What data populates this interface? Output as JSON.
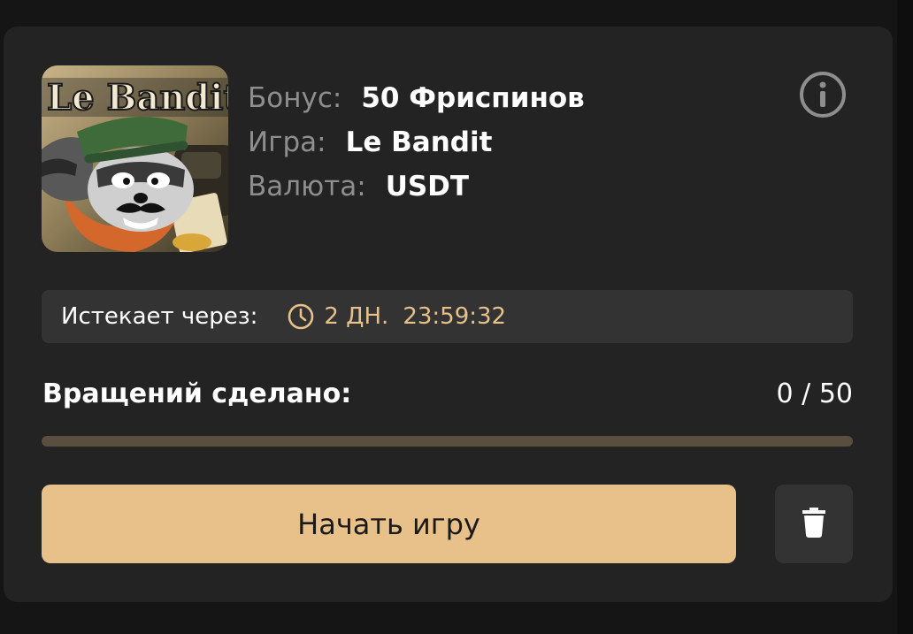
{
  "bonus": {
    "game_image_title": "Le Bandit",
    "rows": [
      {
        "label": "Бонус:",
        "value": "50 Фриспинов"
      },
      {
        "label": "Игра:",
        "value": "Le Bandit"
      },
      {
        "label": "Валюта:",
        "value": "USDT"
      }
    ],
    "info_icon": "info-circle-icon"
  },
  "expiry": {
    "label": "Истекает через:",
    "icon": "clock-icon",
    "days": "2 ДН.",
    "time": "23:59:32"
  },
  "progress": {
    "label": "Вращений сделано:",
    "count_text": "0 / 50",
    "done": 0,
    "total": 50,
    "fraction": 0.0
  },
  "actions": {
    "start_label": "Начать игру",
    "delete_icon": "trash-icon"
  },
  "colors": {
    "accent": "#e7c08a",
    "card": "#232323",
    "panel": "#333333",
    "track": "#5a4e3e"
  }
}
